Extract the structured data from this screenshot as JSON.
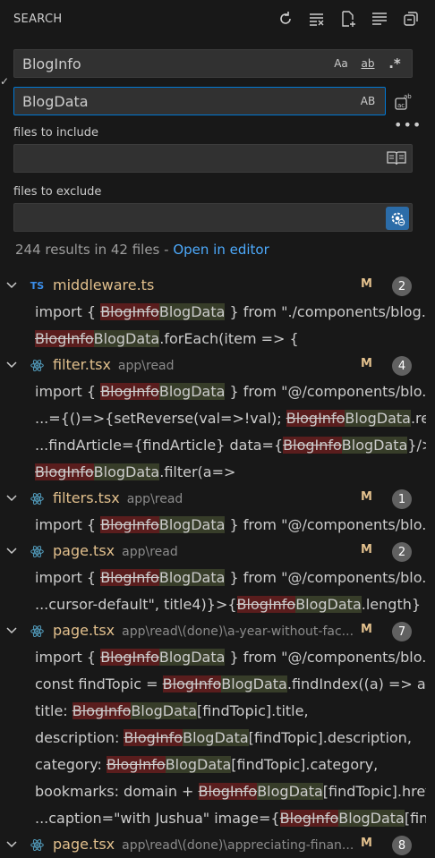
{
  "panel": {
    "title": "SEARCH",
    "actions": [
      "refresh-icon",
      "clear-results-icon",
      "new-search-editor-icon",
      "view-as-tree-icon",
      "collapse-all-icon"
    ]
  },
  "search": {
    "value": "BlogInfo",
    "options": {
      "match_case": "Aa",
      "whole_word": "ab",
      "regex": ".*"
    }
  },
  "replace": {
    "value": "BlogData",
    "preserve_case": "AB"
  },
  "include": {
    "label": "files to include",
    "value": ""
  },
  "exclude": {
    "label": "files to exclude",
    "value": ""
  },
  "summary": {
    "text": "244 results in 42 files - ",
    "link": "Open in editor"
  },
  "results": [
    {
      "icon": "typescript-icon",
      "icon_text": "TS",
      "name": "middleware.ts",
      "path": "",
      "status": "M",
      "count": "2",
      "lines": [
        [
          {
            "t": "import { "
          },
          {
            "d": "BlogInfo"
          },
          {
            "i": "BlogData"
          },
          {
            "t": " } from \"./components/blog..."
          }
        ],
        [
          {
            "d": "BlogInfo"
          },
          {
            "i": "BlogData"
          },
          {
            "t": ".forEach(item => {"
          }
        ]
      ]
    },
    {
      "icon": "react-icon",
      "icon_text": "",
      "name": "filter.tsx",
      "path": "app\\read",
      "status": "M",
      "count": "4",
      "lines": [
        [
          {
            "t": "import { "
          },
          {
            "d": "BlogInfo"
          },
          {
            "i": "BlogData"
          },
          {
            "t": " } from \"@/components/blo..."
          }
        ],
        [
          {
            "t": "...={()=>{setReverse(val=>!val); "
          },
          {
            "d": "BlogInfo"
          },
          {
            "i": "BlogData"
          },
          {
            "t": ".rever..."
          }
        ],
        [
          {
            "t": "...findArticle={findArticle} data={"
          },
          {
            "d": "BlogInfo"
          },
          {
            "i": "BlogData"
          },
          {
            "t": "}/>"
          }
        ],
        [
          {
            "d": "BlogInfo"
          },
          {
            "i": "BlogData"
          },
          {
            "t": ".filter(a=>"
          }
        ]
      ]
    },
    {
      "icon": "react-icon",
      "icon_text": "",
      "name": "filters.tsx",
      "path": "app\\read",
      "status": "M",
      "count": "1",
      "lines": [
        [
          {
            "t": "import { "
          },
          {
            "d": "BlogInfo"
          },
          {
            "i": "BlogData"
          },
          {
            "t": " } from \"@/components/blo..."
          }
        ]
      ]
    },
    {
      "icon": "react-icon",
      "icon_text": "",
      "name": "page.tsx",
      "path": "app\\read",
      "status": "M",
      "count": "2",
      "lines": [
        [
          {
            "t": "import { "
          },
          {
            "d": "BlogInfo"
          },
          {
            "i": "BlogData"
          },
          {
            "t": " } from \"@/components/blo..."
          }
        ],
        [
          {
            "t": "...cursor-default\", title4)}>{"
          },
          {
            "d": "BlogInfo"
          },
          {
            "i": "BlogData"
          },
          {
            "t": ".length} In..."
          }
        ]
      ]
    },
    {
      "icon": "react-icon",
      "icon_text": "",
      "name": "page.tsx",
      "path": "app\\read\\(done)\\a-year-without-fac...",
      "status": "M",
      "count": "7",
      "lines": [
        [
          {
            "t": "import { "
          },
          {
            "d": "BlogInfo"
          },
          {
            "i": "BlogData"
          },
          {
            "t": " } from \"@/components/blo..."
          }
        ],
        [
          {
            "t": "const findTopic = "
          },
          {
            "d": "BlogInfo"
          },
          {
            "i": "BlogData"
          },
          {
            "t": ".findIndex((a) => a...."
          }
        ],
        [
          {
            "t": "title: "
          },
          {
            "d": "BlogInfo"
          },
          {
            "i": "BlogData"
          },
          {
            "t": "[findTopic].title,"
          }
        ],
        [
          {
            "t": "description: "
          },
          {
            "d": "BlogInfo"
          },
          {
            "i": "BlogData"
          },
          {
            "t": "[findTopic].description,"
          }
        ],
        [
          {
            "t": "category: "
          },
          {
            "d": "BlogInfo"
          },
          {
            "i": "BlogData"
          },
          {
            "t": "[findTopic].category,"
          }
        ],
        [
          {
            "t": "bookmarks:  domain + "
          },
          {
            "d": "BlogInfo"
          },
          {
            "i": "BlogData"
          },
          {
            "t": "[findTopic].href,"
          }
        ],
        [
          {
            "t": "...caption=\"with Jushua\" image={"
          },
          {
            "d": "BlogInfo"
          },
          {
            "i": "BlogData"
          },
          {
            "t": "[fin..."
          }
        ]
      ]
    },
    {
      "icon": "react-icon",
      "icon_text": "",
      "name": "page.tsx",
      "path": "app\\read\\(done)\\appreciating-finan...",
      "status": "M",
      "count": "8",
      "lines": []
    }
  ]
}
